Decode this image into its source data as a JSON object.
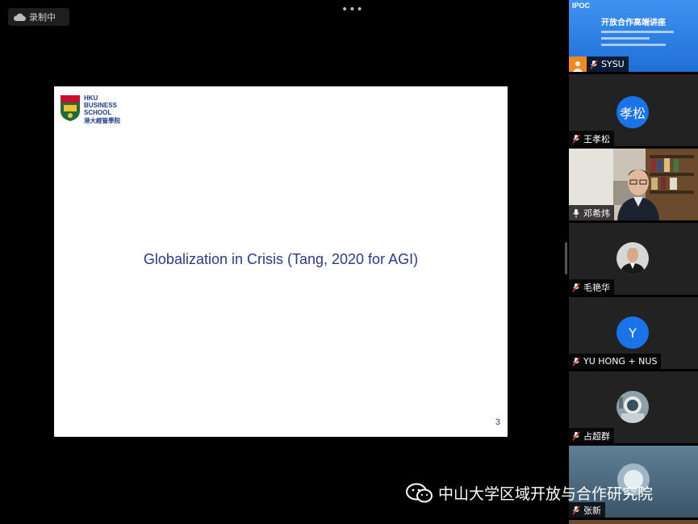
{
  "recording": {
    "label": "录制中",
    "icon": "cloud-icon"
  },
  "top": {
    "more_icon": "more-dots-icon",
    "dots": "•••"
  },
  "slide": {
    "logo_lines": [
      "HKU",
      "BUSINESS",
      "SCHOOL"
    ],
    "logo_cn": "港大經管學院",
    "title": "Globalization in Crisis (Tang, 2020 for AGI)",
    "page_number": "3"
  },
  "participants": [
    {
      "name": "SYSU",
      "type": "banner",
      "banner_logo": "IPOC",
      "banner_title": "开放合作高端讲座"
    },
    {
      "name": "王孝松",
      "type": "avatar",
      "avatar_text": "孝松",
      "avatar_color": "#1a73e8"
    },
    {
      "name": "邓希炜",
      "type": "video",
      "active": true
    },
    {
      "name": "毛艳华",
      "type": "photo"
    },
    {
      "name": "YU HONG + NUS",
      "type": "avatar",
      "avatar_text": "Y",
      "avatar_color": "#1a73e8"
    },
    {
      "name": "占超群",
      "type": "photo"
    },
    {
      "name": "张新",
      "type": "photo"
    }
  ],
  "watermark": {
    "text": "中山大学区域开放与合作研究院",
    "icon": "wechat-icon"
  },
  "colors": {
    "active_speaker": "#35c76b",
    "accent": "#1a73e8",
    "slide_title": "#2c3a8a"
  }
}
